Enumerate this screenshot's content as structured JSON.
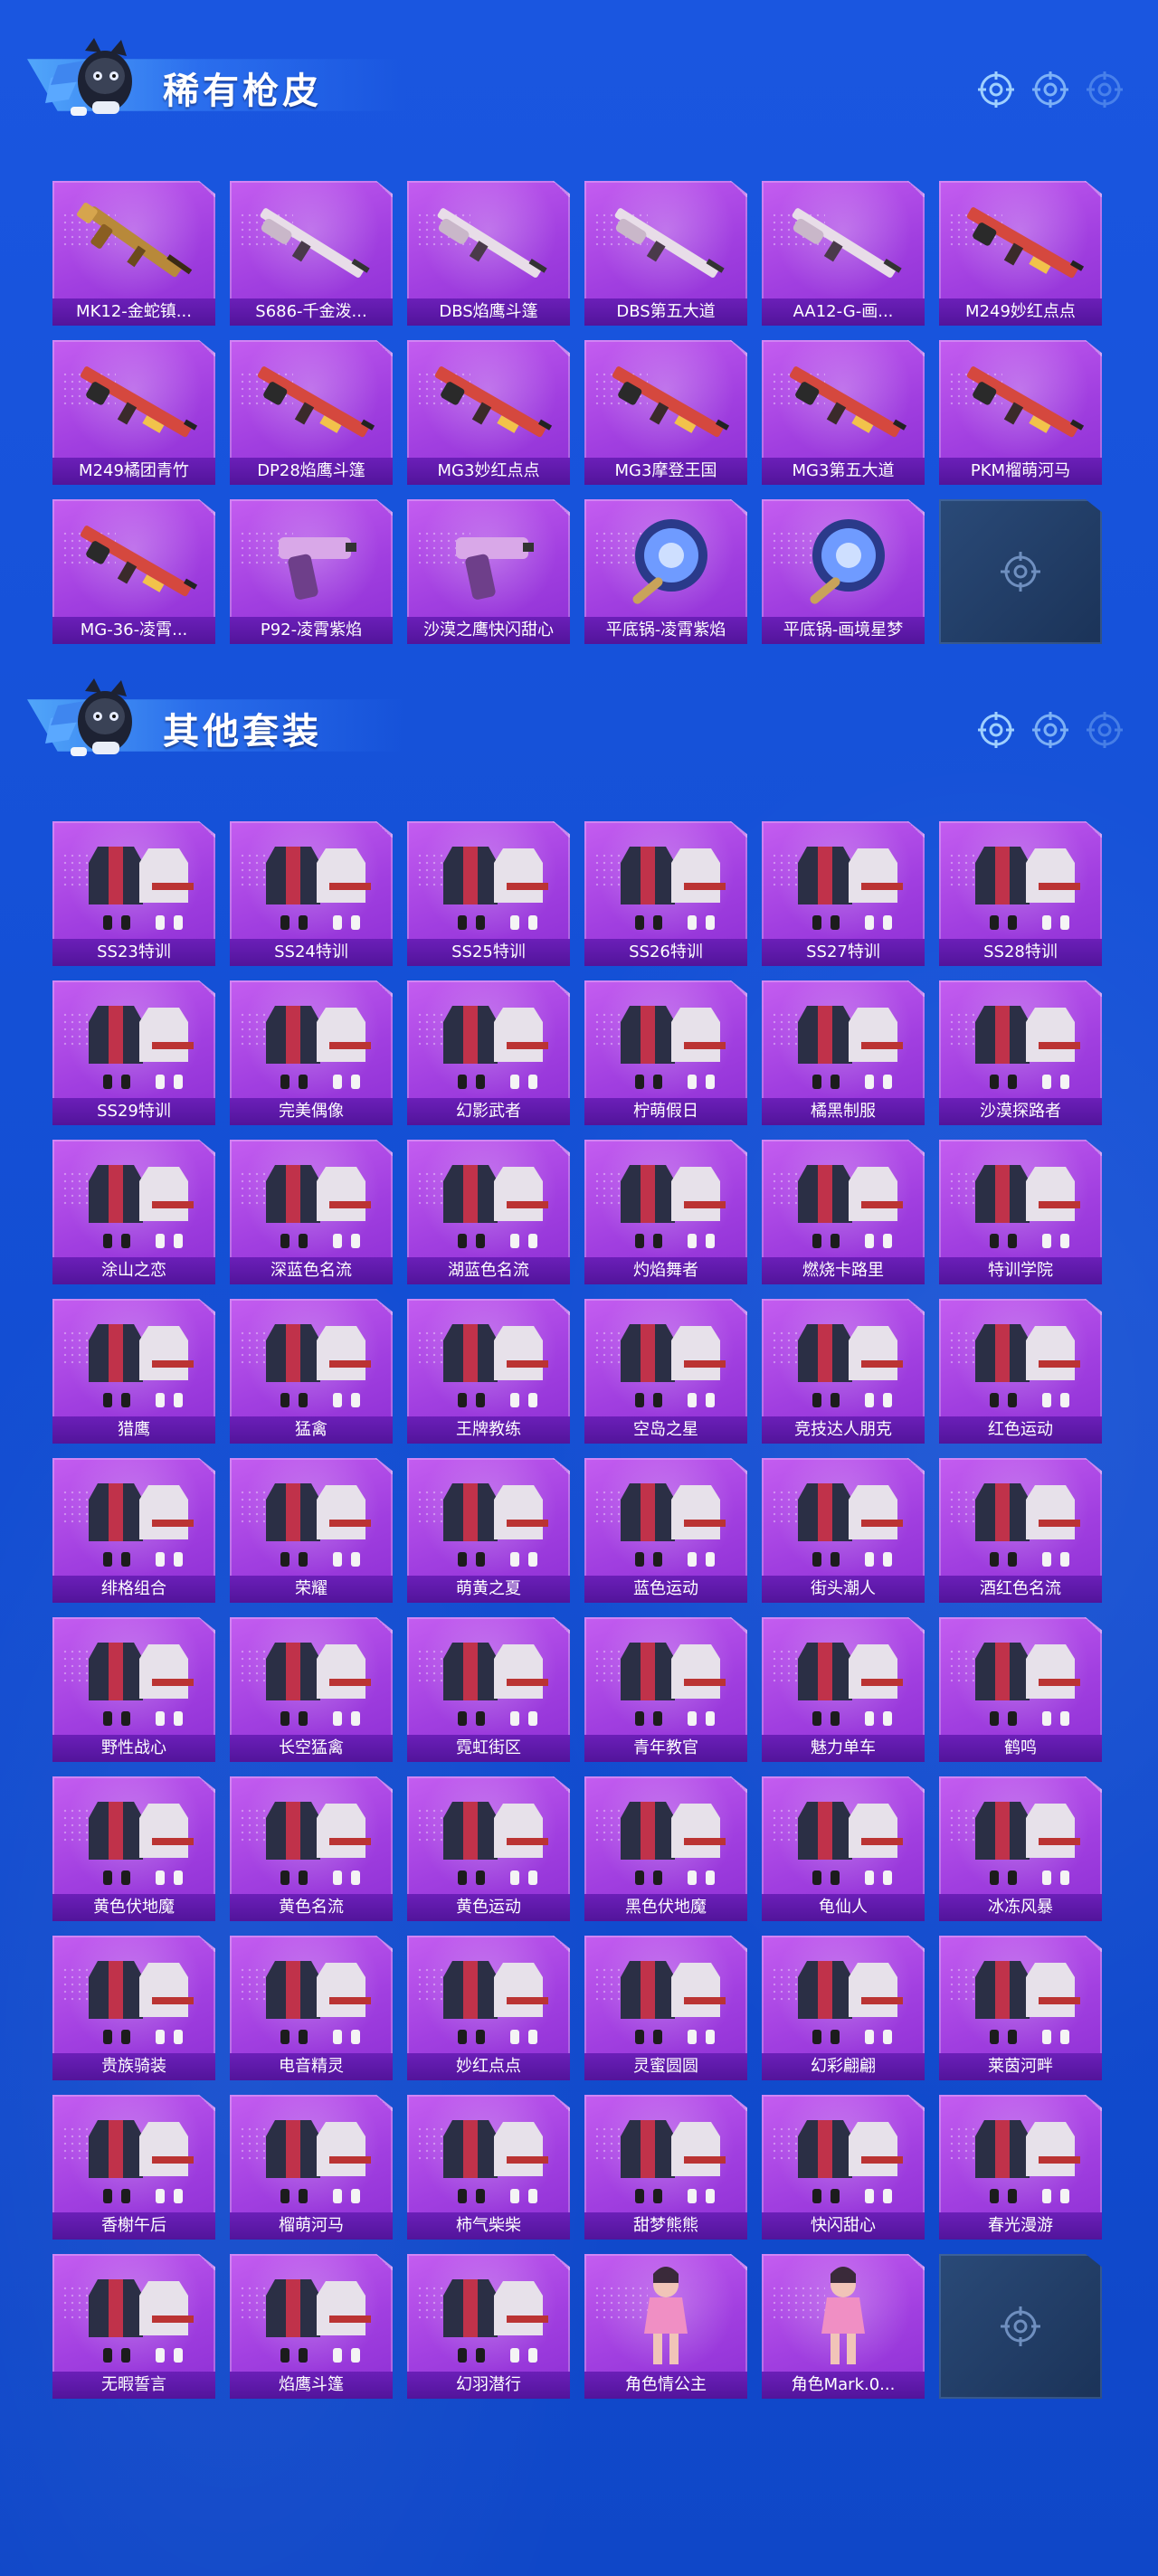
{
  "sections": [
    {
      "title": "稀有枪皮",
      "items": [
        {
          "label": "MK12-金蛇镇...",
          "art": "rifle-icon"
        },
        {
          "label": "S686-千金泼...",
          "art": "shotgun-icon"
        },
        {
          "label": "DBS焰鹰斗篷",
          "art": "shotgun-icon"
        },
        {
          "label": "DBS第五大道",
          "art": "shotgun-icon"
        },
        {
          "label": "AA12-G-画...",
          "art": "shotgun-icon"
        },
        {
          "label": "M249妙红点点",
          "art": "machine-gun-icon"
        },
        {
          "label": "M249橘团青竹",
          "art": "machine-gun-icon"
        },
        {
          "label": "DP28焰鹰斗篷",
          "art": "machine-gun-icon"
        },
        {
          "label": "MG3妙红点点",
          "art": "machine-gun-icon"
        },
        {
          "label": "MG3摩登王国",
          "art": "machine-gun-icon"
        },
        {
          "label": "MG3第五大道",
          "art": "machine-gun-icon"
        },
        {
          "label": "PKM榴萌河马",
          "art": "machine-gun-icon"
        },
        {
          "label": "MG-36-凌霄...",
          "art": "machine-gun-icon"
        },
        {
          "label": "P92-凌霄紫焰",
          "art": "pistol-icon"
        },
        {
          "label": "沙漠之鹰快闪甜心",
          "art": "pistol-icon"
        },
        {
          "label": "平底锅-凌霄紫焰",
          "art": "pan-icon"
        },
        {
          "label": "平底锅-画境星梦",
          "art": "pan-icon"
        }
      ]
    },
    {
      "title": "其他套装",
      "items": [
        {
          "label": "SS23特训",
          "art": "outfit-icon"
        },
        {
          "label": "SS24特训",
          "art": "outfit-icon"
        },
        {
          "label": "SS25特训",
          "art": "outfit-icon"
        },
        {
          "label": "SS26特训",
          "art": "outfit-icon"
        },
        {
          "label": "SS27特训",
          "art": "outfit-icon"
        },
        {
          "label": "SS28特训",
          "art": "outfit-icon"
        },
        {
          "label": "SS29特训",
          "art": "outfit-icon"
        },
        {
          "label": "完美偶像",
          "art": "outfit-icon"
        },
        {
          "label": "幻影武者",
          "art": "outfit-icon"
        },
        {
          "label": "柠萌假日",
          "art": "outfit-icon"
        },
        {
          "label": "橘黑制服",
          "art": "outfit-icon"
        },
        {
          "label": "沙漠探路者",
          "art": "outfit-icon"
        },
        {
          "label": "涂山之恋",
          "art": "outfit-icon"
        },
        {
          "label": "深蓝色名流",
          "art": "outfit-icon"
        },
        {
          "label": "湖蓝色名流",
          "art": "outfit-icon"
        },
        {
          "label": "灼焰舞者",
          "art": "outfit-icon"
        },
        {
          "label": "燃烧卡路里",
          "art": "outfit-icon"
        },
        {
          "label": "特训学院",
          "art": "outfit-icon"
        },
        {
          "label": "猎鹰",
          "art": "outfit-icon"
        },
        {
          "label": "猛禽",
          "art": "outfit-icon"
        },
        {
          "label": "王牌教练",
          "art": "outfit-icon"
        },
        {
          "label": "空岛之星",
          "art": "outfit-icon"
        },
        {
          "label": "竞技达人朋克",
          "art": "outfit-icon"
        },
        {
          "label": "红色运动",
          "art": "outfit-icon"
        },
        {
          "label": "绯格组合",
          "art": "outfit-icon"
        },
        {
          "label": "荣耀",
          "art": "outfit-icon"
        },
        {
          "label": "萌黄之夏",
          "art": "outfit-icon"
        },
        {
          "label": "蓝色运动",
          "art": "outfit-icon"
        },
        {
          "label": "街头潮人",
          "art": "outfit-icon"
        },
        {
          "label": "酒红色名流",
          "art": "outfit-icon"
        },
        {
          "label": "野性战心",
          "art": "outfit-icon"
        },
        {
          "label": "长空猛禽",
          "art": "outfit-icon"
        },
        {
          "label": "霓虹街区",
          "art": "outfit-icon"
        },
        {
          "label": "青年教官",
          "art": "outfit-icon"
        },
        {
          "label": "魅力单车",
          "art": "outfit-icon"
        },
        {
          "label": "鹤鸣",
          "art": "outfit-icon"
        },
        {
          "label": "黄色伏地魔",
          "art": "outfit-icon"
        },
        {
          "label": "黄色名流",
          "art": "outfit-icon"
        },
        {
          "label": "黄色运动",
          "art": "outfit-icon"
        },
        {
          "label": "黑色伏地魔",
          "art": "outfit-icon"
        },
        {
          "label": "龟仙人",
          "art": "outfit-icon"
        },
        {
          "label": "冰冻风暴",
          "art": "outfit-icon"
        },
        {
          "label": "贵族骑装",
          "art": "outfit-icon"
        },
        {
          "label": "电音精灵",
          "art": "outfit-icon"
        },
        {
          "label": "妙红点点",
          "art": "outfit-icon"
        },
        {
          "label": "灵蜜圆圆",
          "art": "outfit-icon"
        },
        {
          "label": "幻彩翩翩",
          "art": "outfit-icon"
        },
        {
          "label": "莱茵河畔",
          "art": "outfit-icon"
        },
        {
          "label": "香榭午后",
          "art": "outfit-icon"
        },
        {
          "label": "榴萌河马",
          "art": "outfit-icon"
        },
        {
          "label": "柿气柴柴",
          "art": "outfit-icon"
        },
        {
          "label": "甜梦熊熊",
          "art": "outfit-icon"
        },
        {
          "label": "快闪甜心",
          "art": "outfit-icon"
        },
        {
          "label": "春光漫游",
          "art": "outfit-icon"
        },
        {
          "label": "无暇誓言",
          "art": "outfit-icon"
        },
        {
          "label": "焰鹰斗篷",
          "art": "outfit-icon"
        },
        {
          "label": "幻羽潜行",
          "art": "outfit-icon"
        },
        {
          "label": "角色情公主",
          "art": "character-icon"
        },
        {
          "label": "角色Mark.0...",
          "art": "character-icon"
        }
      ]
    }
  ],
  "colors": {
    "background": "#1450d6",
    "card_purple": "#a13fe0",
    "label_bar": "#5a169f",
    "empty_slot": "#22406b"
  }
}
